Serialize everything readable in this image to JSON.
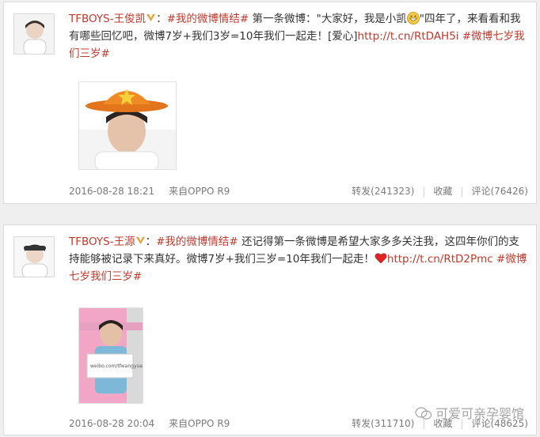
{
  "posts": [
    {
      "username": "TFBOYS-王俊凯",
      "hashtag": "#我的微博情结#",
      "text_a": " 第一条微博：\"大家好，我是小凯",
      "text_b": "\"四年了，来看看和我有哪些回忆吧，微博7岁+我们3岁=10年我们一起走！[爱心]",
      "link": "http://t.cn/RtDAH5i",
      "hashtag2": "#微博七岁我们三岁#",
      "emoji": "grinning-emoji",
      "timestamp": "2016-08-28 18:21",
      "source": "来自OPPO R9",
      "repost": "转发(241323)",
      "favorite": "收藏",
      "comment": "评论(76426)"
    },
    {
      "username": "TFBOYS-王源",
      "hashtag": "#我的微博情结#",
      "text_a": " 还记得第一条微博是希望大家多多关注我，这四年你们的支持能够被记录下来真好。微博7岁+我们三岁=10年我们一起走！",
      "link": "http://t.cn/RtD2Pmc",
      "hashtag2": "#微博七岁我们三岁#",
      "emoji": "heart-emoji",
      "timestamp": "2016-08-28 20:04",
      "source": "来自OPPO R9",
      "repost": "转发(311710)",
      "favorite": "收藏",
      "comment": "评论(48625)"
    }
  ],
  "watermark": "可爱可亲孕婴馆",
  "colors": {
    "accent": "#c0392b",
    "meta": "#7a7a7a"
  }
}
